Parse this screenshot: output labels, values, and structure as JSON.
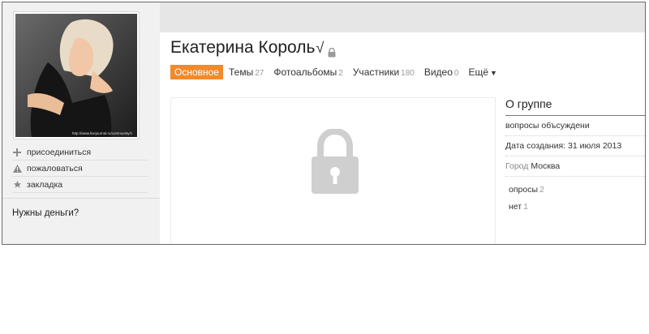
{
  "group": {
    "title": "Екатерина Король",
    "verified_mark": "√",
    "avatar_caption": "http://www.livejournal.ru/community/1"
  },
  "tabs": [
    {
      "label": "Основное",
      "count": "",
      "active": true
    },
    {
      "label": "Темы",
      "count": "27",
      "active": false
    },
    {
      "label": "Фотоальбомы",
      "count": "2",
      "active": false
    },
    {
      "label": "Участники",
      "count": "180",
      "active": false
    },
    {
      "label": "Видео",
      "count": "0",
      "active": false
    },
    {
      "label": "Ещё",
      "count": "",
      "active": false,
      "arrow": "▼"
    }
  ],
  "sidebar": {
    "actions": [
      {
        "label": "присоединиться",
        "icon": "plus-icon"
      },
      {
        "label": "пожаловаться",
        "icon": "warning-icon"
      },
      {
        "label": "закладка",
        "icon": "star-icon"
      }
    ],
    "ad_title": "Нужны деньги?"
  },
  "about": {
    "title": "О группе",
    "description": "вопросы объсуждени",
    "created": "Дата создания: 31 июля 2013",
    "city_label": "Город",
    "city_value": "Москва",
    "polls": [
      {
        "label": "опросы",
        "count": "2"
      },
      {
        "label": "нет",
        "count": "1"
      }
    ]
  },
  "colors": {
    "accent": "#f08a2c",
    "topbar": "#e6e6e6",
    "sidebar": "#f1f1f1",
    "lock": "#cfcfcf"
  }
}
